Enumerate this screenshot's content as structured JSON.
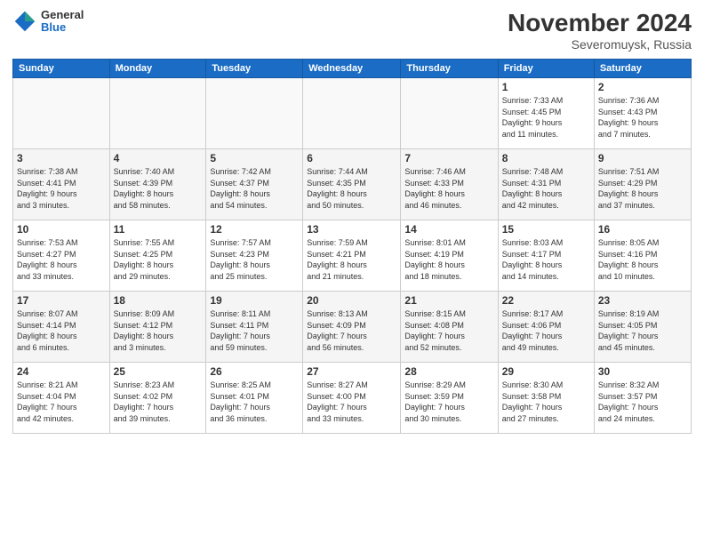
{
  "header": {
    "logo_general": "General",
    "logo_blue": "Blue",
    "month_title": "November 2024",
    "location": "Severomuysk, Russia"
  },
  "weekdays": [
    "Sunday",
    "Monday",
    "Tuesday",
    "Wednesday",
    "Thursday",
    "Friday",
    "Saturday"
  ],
  "weeks": [
    [
      {
        "day": "",
        "info": ""
      },
      {
        "day": "",
        "info": ""
      },
      {
        "day": "",
        "info": ""
      },
      {
        "day": "",
        "info": ""
      },
      {
        "day": "",
        "info": ""
      },
      {
        "day": "1",
        "info": "Sunrise: 7:33 AM\nSunset: 4:45 PM\nDaylight: 9 hours\nand 11 minutes."
      },
      {
        "day": "2",
        "info": "Sunrise: 7:36 AM\nSunset: 4:43 PM\nDaylight: 9 hours\nand 7 minutes."
      }
    ],
    [
      {
        "day": "3",
        "info": "Sunrise: 7:38 AM\nSunset: 4:41 PM\nDaylight: 9 hours\nand 3 minutes."
      },
      {
        "day": "4",
        "info": "Sunrise: 7:40 AM\nSunset: 4:39 PM\nDaylight: 8 hours\nand 58 minutes."
      },
      {
        "day": "5",
        "info": "Sunrise: 7:42 AM\nSunset: 4:37 PM\nDaylight: 8 hours\nand 54 minutes."
      },
      {
        "day": "6",
        "info": "Sunrise: 7:44 AM\nSunset: 4:35 PM\nDaylight: 8 hours\nand 50 minutes."
      },
      {
        "day": "7",
        "info": "Sunrise: 7:46 AM\nSunset: 4:33 PM\nDaylight: 8 hours\nand 46 minutes."
      },
      {
        "day": "8",
        "info": "Sunrise: 7:48 AM\nSunset: 4:31 PM\nDaylight: 8 hours\nand 42 minutes."
      },
      {
        "day": "9",
        "info": "Sunrise: 7:51 AM\nSunset: 4:29 PM\nDaylight: 8 hours\nand 37 minutes."
      }
    ],
    [
      {
        "day": "10",
        "info": "Sunrise: 7:53 AM\nSunset: 4:27 PM\nDaylight: 8 hours\nand 33 minutes."
      },
      {
        "day": "11",
        "info": "Sunrise: 7:55 AM\nSunset: 4:25 PM\nDaylight: 8 hours\nand 29 minutes."
      },
      {
        "day": "12",
        "info": "Sunrise: 7:57 AM\nSunset: 4:23 PM\nDaylight: 8 hours\nand 25 minutes."
      },
      {
        "day": "13",
        "info": "Sunrise: 7:59 AM\nSunset: 4:21 PM\nDaylight: 8 hours\nand 21 minutes."
      },
      {
        "day": "14",
        "info": "Sunrise: 8:01 AM\nSunset: 4:19 PM\nDaylight: 8 hours\nand 18 minutes."
      },
      {
        "day": "15",
        "info": "Sunrise: 8:03 AM\nSunset: 4:17 PM\nDaylight: 8 hours\nand 14 minutes."
      },
      {
        "day": "16",
        "info": "Sunrise: 8:05 AM\nSunset: 4:16 PM\nDaylight: 8 hours\nand 10 minutes."
      }
    ],
    [
      {
        "day": "17",
        "info": "Sunrise: 8:07 AM\nSunset: 4:14 PM\nDaylight: 8 hours\nand 6 minutes."
      },
      {
        "day": "18",
        "info": "Sunrise: 8:09 AM\nSunset: 4:12 PM\nDaylight: 8 hours\nand 3 minutes."
      },
      {
        "day": "19",
        "info": "Sunrise: 8:11 AM\nSunset: 4:11 PM\nDaylight: 7 hours\nand 59 minutes."
      },
      {
        "day": "20",
        "info": "Sunrise: 8:13 AM\nSunset: 4:09 PM\nDaylight: 7 hours\nand 56 minutes."
      },
      {
        "day": "21",
        "info": "Sunrise: 8:15 AM\nSunset: 4:08 PM\nDaylight: 7 hours\nand 52 minutes."
      },
      {
        "day": "22",
        "info": "Sunrise: 8:17 AM\nSunset: 4:06 PM\nDaylight: 7 hours\nand 49 minutes."
      },
      {
        "day": "23",
        "info": "Sunrise: 8:19 AM\nSunset: 4:05 PM\nDaylight: 7 hours\nand 45 minutes."
      }
    ],
    [
      {
        "day": "24",
        "info": "Sunrise: 8:21 AM\nSunset: 4:04 PM\nDaylight: 7 hours\nand 42 minutes."
      },
      {
        "day": "25",
        "info": "Sunrise: 8:23 AM\nSunset: 4:02 PM\nDaylight: 7 hours\nand 39 minutes."
      },
      {
        "day": "26",
        "info": "Sunrise: 8:25 AM\nSunset: 4:01 PM\nDaylight: 7 hours\nand 36 minutes."
      },
      {
        "day": "27",
        "info": "Sunrise: 8:27 AM\nSunset: 4:00 PM\nDaylight: 7 hours\nand 33 minutes."
      },
      {
        "day": "28",
        "info": "Sunrise: 8:29 AM\nSunset: 3:59 PM\nDaylight: 7 hours\nand 30 minutes."
      },
      {
        "day": "29",
        "info": "Sunrise: 8:30 AM\nSunset: 3:58 PM\nDaylight: 7 hours\nand 27 minutes."
      },
      {
        "day": "30",
        "info": "Sunrise: 8:32 AM\nSunset: 3:57 PM\nDaylight: 7 hours\nand 24 minutes."
      }
    ]
  ]
}
